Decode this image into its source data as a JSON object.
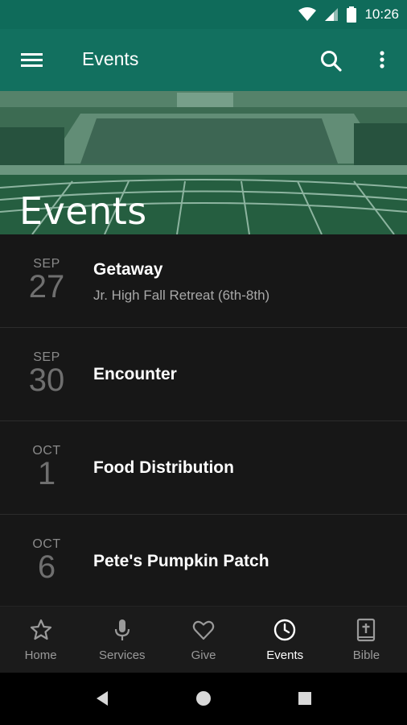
{
  "status": {
    "time": "10:26"
  },
  "appbar": {
    "title": "Events"
  },
  "hero": {
    "title": "Events"
  },
  "events": [
    {
      "month": "SEP",
      "day": "27",
      "title": "Getaway",
      "subtitle": "Jr. High Fall Retreat (6th-8th)"
    },
    {
      "month": "SEP",
      "day": "30",
      "title": "Encounter",
      "subtitle": ""
    },
    {
      "month": "OCT",
      "day": "1",
      "title": "Food Distribution",
      "subtitle": ""
    },
    {
      "month": "OCT",
      "day": "6",
      "title": "Pete's Pumpkin Patch",
      "subtitle": ""
    }
  ],
  "nav": [
    {
      "label": "Home",
      "icon": "star-icon"
    },
    {
      "label": "Services",
      "icon": "microphone-icon"
    },
    {
      "label": "Give",
      "icon": "heart-icon"
    },
    {
      "label": "Events",
      "icon": "clock-icon",
      "active": true
    },
    {
      "label": "Bible",
      "icon": "bible-icon"
    }
  ],
  "colors": {
    "appbar": "#12705f",
    "statusbar": "#0f6b5a",
    "background": "#171717"
  }
}
